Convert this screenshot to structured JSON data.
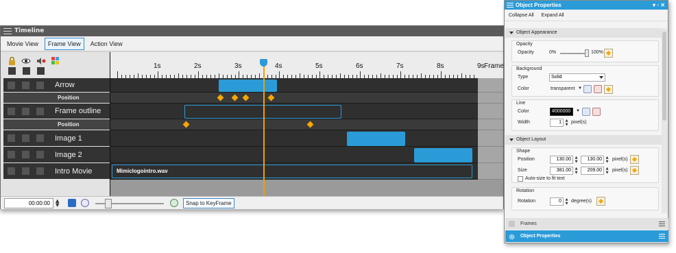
{
  "timeline": {
    "title": "Timeline",
    "tabs": [
      {
        "label": "Movie View",
        "active": false
      },
      {
        "label": "Frame View",
        "active": true
      },
      {
        "label": "Action View",
        "active": false
      }
    ],
    "ruler_labels": [
      "1s",
      "2s",
      "3s",
      "4s",
      "5s",
      "6s",
      "7s",
      "8s",
      "9s"
    ],
    "frame_label": "Frame",
    "playhead_seconds": 3.6,
    "rows": [
      {
        "name": "Arrow",
        "type": "main"
      },
      {
        "name": "Position",
        "type": "sub"
      },
      {
        "name": "Frame outline",
        "type": "main"
      },
      {
        "name": "Position",
        "type": "sub"
      },
      {
        "name": "Image 1",
        "type": "main"
      },
      {
        "name": "Image 2",
        "type": "main"
      },
      {
        "name": "Intro Movie",
        "type": "main"
      }
    ],
    "clip_label": "Mimiclogointro.wav",
    "time_value": "00:00:00",
    "snap_label": "Snap to KeyFrame"
  },
  "props": {
    "title": "Object Properties",
    "collapse_all": "Collapse All",
    "expand_all": "Expand All",
    "appearance_section": "Object Appearance",
    "opacity_group": "Opacity",
    "opacity_label": "Opacity",
    "opacity_min": "0%",
    "opacity_max": "100%",
    "opacity_value": 1.0,
    "background_group": "Background",
    "type_label": "Type",
    "type_value": "Solid",
    "color_label": "Color",
    "bg_color_value": "transparent",
    "line_group": "Line",
    "line_color_label": "Color",
    "line_color_value": "#000000",
    "width_label": "Width",
    "width_value": "1",
    "pixels_label": "pixel(s)",
    "layout_section": "Object Layout",
    "shape_group": "Shape",
    "position_label": "Position",
    "pos_x": "130.00",
    "pos_y": "130.00",
    "size_label": "Size",
    "size_w": "381.00",
    "size_h": "209.00",
    "autosize_label": "Auto-size to fit text",
    "rotation_group": "Rotation",
    "rotation_label": "Rotation",
    "rotation_value": "0",
    "degrees_label": "degree(s)",
    "frames_bar": "Frames",
    "props_bar": "Object Properties"
  },
  "colors": {
    "accent": "#2b9bd8",
    "keyframe": "#f5a800",
    "playhead": "#f0a000",
    "row_dark": "#333333"
  }
}
